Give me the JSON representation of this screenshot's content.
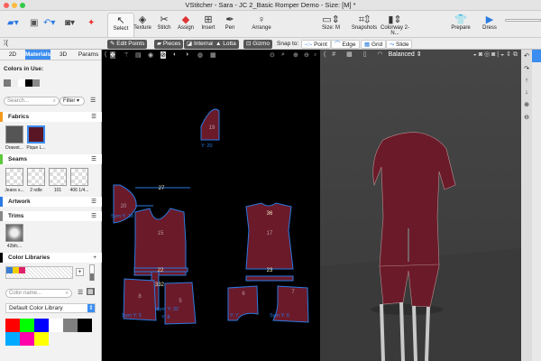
{
  "window": {
    "title": "VStitcher - Sara - JC 2_Basic Romper Demo - Size: [M] *"
  },
  "toolbar": {
    "tools": [
      "Select",
      "Texture",
      "Stitch",
      "Assign",
      "Insert",
      "Pen",
      "Arrange"
    ],
    "size": "Size: M",
    "snapshots": "Snapshots",
    "colorway": "Colorway 2-N...",
    "prepare": "Prepare",
    "dress": "Dress"
  },
  "subbar": {
    "edit_points": "Edit Points",
    "pieces": "Pieces",
    "internal": "Internal",
    "lotta": "Lotta",
    "gizmo": "Gizmo",
    "snap_to": "Snap to:",
    "point": "Point",
    "edge": "Edge",
    "grid": "Grid",
    "slide": "Slide"
  },
  "left": {
    "tabs": [
      "2D",
      "Materials",
      "3D",
      "Params"
    ],
    "colors_in_use": "Colors in Use:",
    "used_colors": [
      "#7a7a7a",
      "#eeeeee",
      "#ffffff",
      "#000000",
      "#8a8a8a"
    ],
    "search_placeholder": "Search...",
    "filter": "Filter",
    "fabrics": {
      "title": "Fabrics",
      "items": [
        "Drawst...",
        "Pique L..."
      ]
    },
    "seams": {
      "title": "Seams",
      "items": [
        "Jeans s...",
        "2 ndle",
        "101",
        "406 1/4..."
      ]
    },
    "artwork": {
      "title": "Artwork"
    },
    "trims": {
      "title": "Trims",
      "items": [
        "42bfc..."
      ]
    },
    "color_libraries": {
      "title": "Color Libraries",
      "color_name_placeholder": "Color name...",
      "library": "Default Color Library",
      "palette": [
        "#ff0000",
        "#00ff00",
        "#0000ff",
        "#ffffff",
        "#808080",
        "#000000",
        "#00aaff",
        "#ff00aa",
        "#ffff00"
      ],
      "recent": [
        "#3a7fd0",
        "#f0d000",
        "#e0206a"
      ]
    }
  },
  "view3d": {
    "quality": "Balanced"
  },
  "pieces": {
    "p19": "19",
    "y20": "Y: 20",
    "p20": "20",
    "sym18": "Sym Y: 18",
    "p27": "27",
    "p15": "15",
    "p22": "22",
    "p332": "332",
    "p8": "8",
    "p5": "5",
    "sym5": "Sym Y: 5",
    "y8": "Y: 8",
    "sym32": "Sym Y: 32",
    "p36": "36",
    "p17": "17",
    "p23": "23",
    "p6": "6",
    "p7": "7",
    "y7": "Y: 7",
    "sym6": "Sym Y: 6"
  }
}
